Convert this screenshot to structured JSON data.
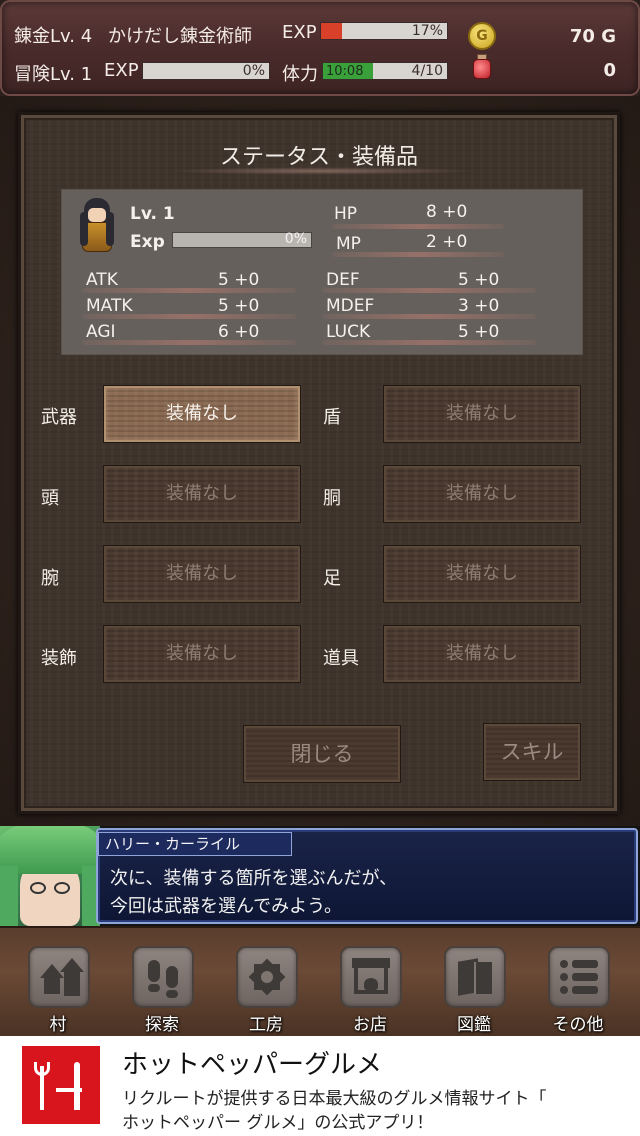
{
  "topbar": {
    "alchemy_level": "錬金Lv. 4",
    "alchemy_title": "かけだし錬金術師",
    "exp_label": "EXP",
    "exp_pct": "17%",
    "exp_fraction": 0.17,
    "gold_value": "70 G",
    "adventure_level": "冒険Lv. 1",
    "adv_exp_label": "EXP",
    "adv_exp_pct": "0%",
    "stamina_label": "体力",
    "stamina_timer": "10:08",
    "stamina_value": "4/10",
    "stamina_fraction": 0.4,
    "potion_count": "0",
    "gold_icon_glyph": "G",
    "colors": {
      "exp_fill": "#d8402a",
      "stamina_fill": "#3aa13a"
    }
  },
  "panel": {
    "title": "ステータス・装備品",
    "character": {
      "level": "Lv. 1",
      "exp_label": "Exp",
      "exp_pct": "0%",
      "hp_label": "HP",
      "hp_value": "8 +0",
      "mp_label": "MP",
      "mp_value": "2 +0"
    },
    "stats": [
      {
        "label": "ATK",
        "value": "5 +0"
      },
      {
        "label": "MATK",
        "value": "5 +0"
      },
      {
        "label": "AGI",
        "value": "6 +0"
      },
      {
        "label": "DEF",
        "value": "5 +0"
      },
      {
        "label": "MDEF",
        "value": "3 +0"
      },
      {
        "label": "LUCK",
        "value": "5 +0"
      }
    ],
    "equipment": [
      {
        "slot": "武器",
        "value": "装備なし"
      },
      {
        "slot": "盾",
        "value": "装備なし"
      },
      {
        "slot": "頭",
        "value": "装備なし"
      },
      {
        "slot": "胴",
        "value": "装備なし"
      },
      {
        "slot": "腕",
        "value": "装備なし"
      },
      {
        "slot": "足",
        "value": "装備なし"
      },
      {
        "slot": "装飾",
        "value": "装備なし"
      },
      {
        "slot": "道具",
        "value": "装備なし"
      }
    ],
    "close_label": "閉じる",
    "skill_label": "スキル"
  },
  "dialog": {
    "speaker": "ハリー・カーライル",
    "line1": "次に、装備する箇所を選ぶんだが、",
    "line2": "今回は武器を選んでみよう。"
  },
  "nav": [
    {
      "label": "村",
      "icon": "village-icon"
    },
    {
      "label": "探索",
      "icon": "footprints-icon"
    },
    {
      "label": "工房",
      "icon": "workshop-icon"
    },
    {
      "label": "お店",
      "icon": "shop-icon"
    },
    {
      "label": "図鑑",
      "icon": "book-icon"
    },
    {
      "label": "その他",
      "icon": "menu-list-icon"
    }
  ],
  "ad": {
    "title": "ホットペッパーグルメ",
    "line1": "リクルートが提供する日本最大級のグルメ情報サイト「",
    "line2": "ホットペッパー グルメ」の公式アプリ！"
  }
}
